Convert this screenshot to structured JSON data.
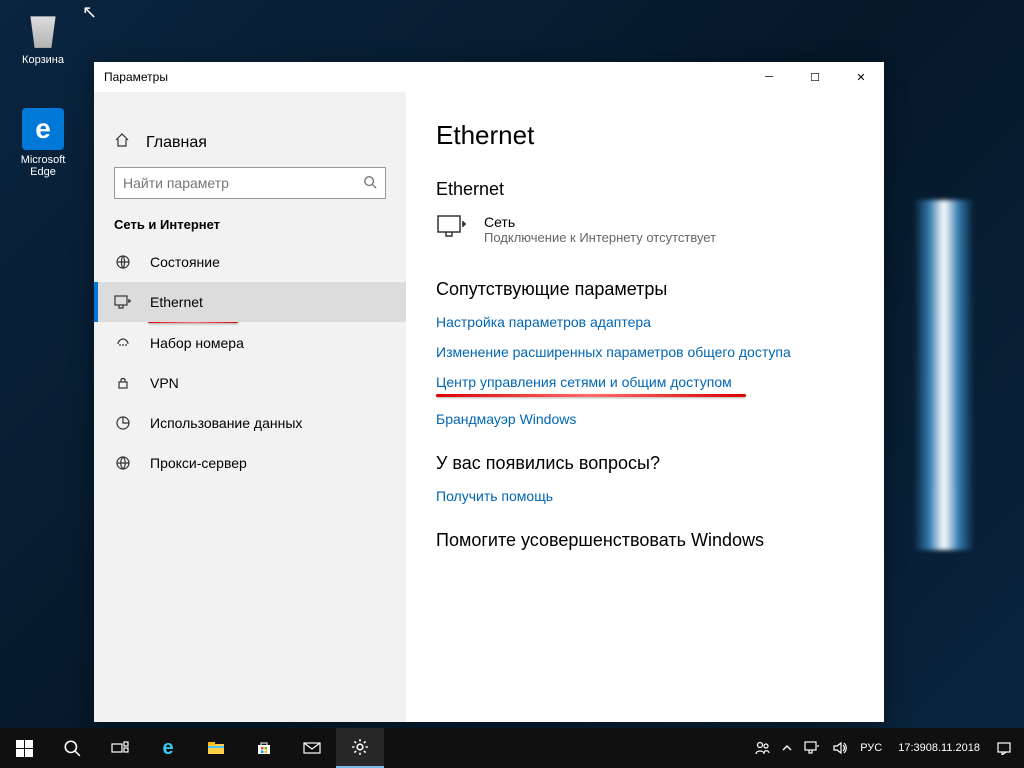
{
  "desktop": {
    "recycle_bin": "Корзина",
    "edge": "Microsoft Edge"
  },
  "window": {
    "title": "Параметры"
  },
  "sidebar": {
    "home": "Главная",
    "search_placeholder": "Найти параметр",
    "section": "Сеть и Интернет",
    "items": [
      {
        "label": "Состояние"
      },
      {
        "label": "Ethernet"
      },
      {
        "label": "Набор номера"
      },
      {
        "label": "VPN"
      },
      {
        "label": "Использование данных"
      },
      {
        "label": "Прокси-сервер"
      }
    ]
  },
  "content": {
    "title": "Ethernet",
    "subtitle": "Ethernet",
    "network_name": "Сеть",
    "network_status": "Подключение к Интернету отсутствует",
    "related_heading": "Сопутствующие параметры",
    "links": [
      "Настройка параметров адаптера",
      "Изменение расширенных параметров общего доступа",
      "Центр управления сетями и общим доступом",
      "Брандмауэр Windows"
    ],
    "questions_heading": "У вас появились вопросы?",
    "get_help": "Получить помощь",
    "improve_heading": "Помогите усовершенствовать Windows"
  },
  "taskbar": {
    "lang": "РУС",
    "time": "17:39",
    "date": "08.11.2018"
  }
}
